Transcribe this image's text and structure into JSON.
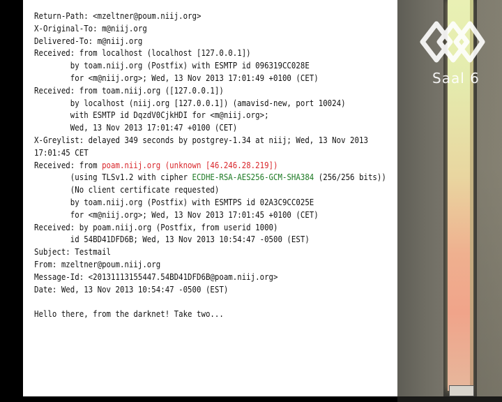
{
  "email": {
    "lines": [
      [
        {
          "t": "Return-Path: <mzeltner@poum.niij.org>"
        }
      ],
      [
        {
          "t": "X-Original-To: m@niij.org"
        }
      ],
      [
        {
          "t": "Delivered-To: m@niij.org"
        }
      ],
      [
        {
          "t": "Received: from localhost (localhost [127.0.0.1])"
        }
      ],
      [
        {
          "t": "        by toam.niij.org (Postfix) with ESMTP id 096319CC028E"
        }
      ],
      [
        {
          "t": "        for <m@niij.org>; Wed, 13 Nov 2013 17:01:49 +0100 (CET)"
        }
      ],
      [
        {
          "t": "Received: from toam.niij.org ([127.0.0.1])"
        }
      ],
      [
        {
          "t": "        by localhost (niij.org [127.0.0.1]) (amavisd-new, port 10024)"
        }
      ],
      [
        {
          "t": "        with ESMTP id DqzdV0CjkHDI for <m@niij.org>;"
        }
      ],
      [
        {
          "t": "        Wed, 13 Nov 2013 17:01:47 +0100 (CET)"
        }
      ],
      [
        {
          "t": "X-Greylist: delayed 349 seconds by postgrey-1.34 at niij; Wed, 13 Nov 2013"
        }
      ],
      [
        {
          "t": "17:01:45 CET"
        }
      ],
      [
        {
          "t": "Received: from "
        },
        {
          "t": "poam.niij.org (unknown [46.246.28.219])",
          "c": "red"
        }
      ],
      [
        {
          "t": "        (using TLSv1.2 with cipher "
        },
        {
          "t": "ECDHE-RSA-AES256-GCM-SHA384",
          "c": "green"
        },
        {
          "t": " (256/256 bits))"
        }
      ],
      [
        {
          "t": "        (No client certificate requested)"
        }
      ],
      [
        {
          "t": "        by toam.niij.org (Postfix) with ESMTPS id 02A3C9CC025E"
        }
      ],
      [
        {
          "t": "        for <m@niij.org>; Wed, 13 Nov 2013 17:01:45 +0100 (CET)"
        }
      ],
      [
        {
          "t": "Received: by poam.niij.org (Postfix, from userid 1000)"
        }
      ],
      [
        {
          "t": "        id 54BD41DFD6B; Wed, 13 Nov 2013 10:54:47 -0500 (EST)"
        }
      ],
      [
        {
          "t": "Subject: Testmail"
        }
      ],
      [
        {
          "t": "From: mzeltner@poum.niij.org"
        }
      ],
      [
        {
          "t": "Message-Id: <20131113155447.54BD41DFD6B@poam.niij.org>"
        }
      ],
      [
        {
          "t": "Date: Wed, 13 Nov 2013 10:54:47 -0500 (EST)"
        }
      ],
      [
        {
          "t": ""
        }
      ],
      [
        {
          "t": "Hello there, from the darknet! Take two..."
        }
      ]
    ]
  },
  "venue": {
    "sign_text": "Saal 6"
  },
  "colors": {
    "highlight_red": "#d9262b",
    "highlight_green": "#1d7a24",
    "text": "#111111",
    "background": "#ffffff"
  }
}
